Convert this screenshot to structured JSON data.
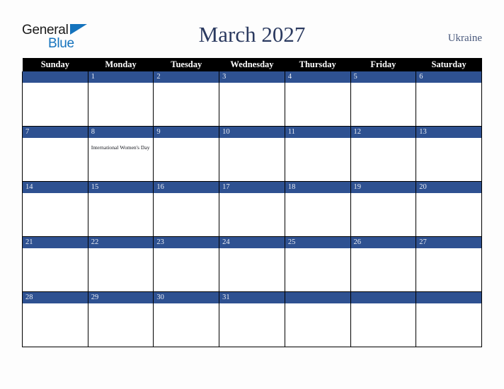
{
  "brand": {
    "logo_primary": "General",
    "logo_secondary": "Blue",
    "flag_icon": "blue-triangle-flag-icon",
    "accent_color": "#1573bd"
  },
  "header": {
    "title": "March 2027",
    "country": "Ukraine",
    "title_color": "#2b3a60",
    "country_color": "#4a5a7d"
  },
  "calendar": {
    "month": "March",
    "year": "2027",
    "weekday_headers": [
      "Sunday",
      "Monday",
      "Tuesday",
      "Wednesday",
      "Thursday",
      "Friday",
      "Saturday"
    ],
    "header_bg": "#000000",
    "header_text_color": "#ffffff",
    "daynum_band_color": "#2e5191",
    "daynum_text_color": "#e8ecf5",
    "cell_bg": "#ffffff",
    "grid_line_color": "#000000",
    "weeks": [
      [
        {
          "date": "",
          "event": ""
        },
        {
          "date": "1",
          "event": ""
        },
        {
          "date": "2",
          "event": ""
        },
        {
          "date": "3",
          "event": ""
        },
        {
          "date": "4",
          "event": ""
        },
        {
          "date": "5",
          "event": ""
        },
        {
          "date": "6",
          "event": ""
        }
      ],
      [
        {
          "date": "7",
          "event": ""
        },
        {
          "date": "8",
          "event": "International Women's Day"
        },
        {
          "date": "9",
          "event": ""
        },
        {
          "date": "10",
          "event": ""
        },
        {
          "date": "11",
          "event": ""
        },
        {
          "date": "12",
          "event": ""
        },
        {
          "date": "13",
          "event": ""
        }
      ],
      [
        {
          "date": "14",
          "event": ""
        },
        {
          "date": "15",
          "event": ""
        },
        {
          "date": "16",
          "event": ""
        },
        {
          "date": "17",
          "event": ""
        },
        {
          "date": "18",
          "event": ""
        },
        {
          "date": "19",
          "event": ""
        },
        {
          "date": "20",
          "event": ""
        }
      ],
      [
        {
          "date": "21",
          "event": ""
        },
        {
          "date": "22",
          "event": ""
        },
        {
          "date": "23",
          "event": ""
        },
        {
          "date": "24",
          "event": ""
        },
        {
          "date": "25",
          "event": ""
        },
        {
          "date": "26",
          "event": ""
        },
        {
          "date": "27",
          "event": ""
        }
      ],
      [
        {
          "date": "28",
          "event": ""
        },
        {
          "date": "29",
          "event": ""
        },
        {
          "date": "30",
          "event": ""
        },
        {
          "date": "31",
          "event": ""
        },
        {
          "date": "",
          "event": ""
        },
        {
          "date": "",
          "event": ""
        },
        {
          "date": "",
          "event": ""
        }
      ]
    ]
  }
}
